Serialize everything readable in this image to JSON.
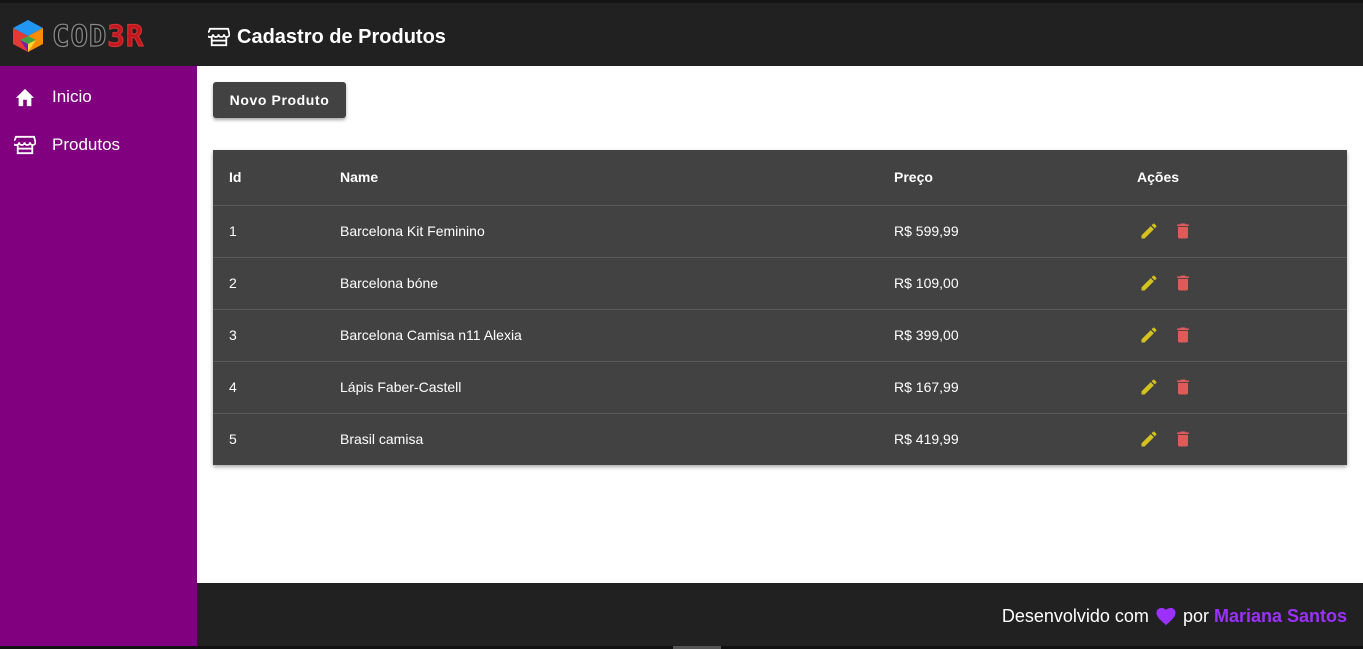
{
  "header": {
    "logo_text_a": "COD",
    "logo_text_b": "3R",
    "title": "Cadastro de Produtos"
  },
  "sidebar": {
    "items": [
      {
        "label": "Inicio",
        "icon": "home-icon"
      },
      {
        "label": "Produtos",
        "icon": "storefront-icon"
      }
    ]
  },
  "toolbar": {
    "new_label": "Novo Produto"
  },
  "table": {
    "columns": [
      "Id",
      "Name",
      "Preço",
      "Ações"
    ],
    "rows": [
      {
        "id": "1",
        "name": "Barcelona Kit Feminino",
        "price": "R$ 599,99"
      },
      {
        "id": "2",
        "name": "Barcelona bóne",
        "price": "R$ 109,00"
      },
      {
        "id": "3",
        "name": "Barcelona Camisa n11 Alexia",
        "price": "R$ 399,00"
      },
      {
        "id": "4",
        "name": "Lápis Faber-Castell",
        "price": "R$ 167,99"
      },
      {
        "id": "5",
        "name": "Brasil camisa",
        "price": "R$ 419,99"
      }
    ],
    "edit_icon": "pencil-icon",
    "delete_icon": "trash-icon"
  },
  "footer": {
    "text_before": "Desenvolvido com",
    "text_after": "por",
    "author": "Mariana Santos"
  },
  "colors": {
    "header_bg": "#212121",
    "sidebar_bg": "#800080",
    "table_bg": "#424242",
    "edit": "#d4c21d",
    "delete": "#e05a5a",
    "heart": "#9b30ff",
    "author": "#9b30ff"
  }
}
